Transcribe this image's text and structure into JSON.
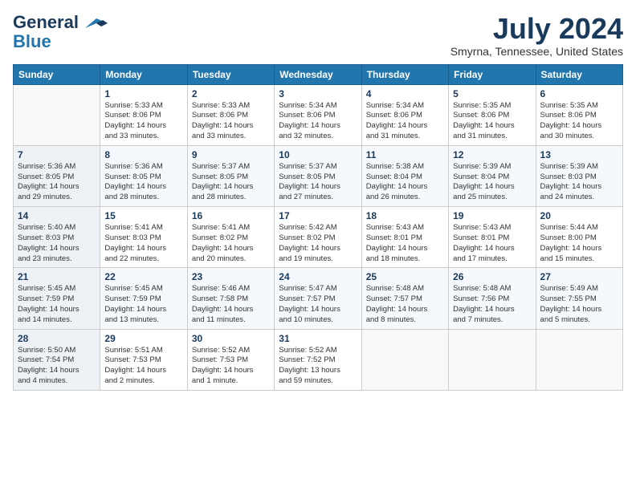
{
  "header": {
    "logo_line1": "General",
    "logo_line2": "Blue",
    "month_title": "July 2024",
    "location": "Smyrna, Tennessee, United States"
  },
  "weekdays": [
    "Sunday",
    "Monday",
    "Tuesday",
    "Wednesday",
    "Thursday",
    "Friday",
    "Saturday"
  ],
  "weeks": [
    [
      {
        "day": "",
        "info": ""
      },
      {
        "day": "1",
        "info": "Sunrise: 5:33 AM\nSunset: 8:06 PM\nDaylight: 14 hours\nand 33 minutes."
      },
      {
        "day": "2",
        "info": "Sunrise: 5:33 AM\nSunset: 8:06 PM\nDaylight: 14 hours\nand 33 minutes."
      },
      {
        "day": "3",
        "info": "Sunrise: 5:34 AM\nSunset: 8:06 PM\nDaylight: 14 hours\nand 32 minutes."
      },
      {
        "day": "4",
        "info": "Sunrise: 5:34 AM\nSunset: 8:06 PM\nDaylight: 14 hours\nand 31 minutes."
      },
      {
        "day": "5",
        "info": "Sunrise: 5:35 AM\nSunset: 8:06 PM\nDaylight: 14 hours\nand 31 minutes."
      },
      {
        "day": "6",
        "info": "Sunrise: 5:35 AM\nSunset: 8:06 PM\nDaylight: 14 hours\nand 30 minutes."
      }
    ],
    [
      {
        "day": "7",
        "info": "Sunrise: 5:36 AM\nSunset: 8:05 PM\nDaylight: 14 hours\nand 29 minutes."
      },
      {
        "day": "8",
        "info": "Sunrise: 5:36 AM\nSunset: 8:05 PM\nDaylight: 14 hours\nand 28 minutes."
      },
      {
        "day": "9",
        "info": "Sunrise: 5:37 AM\nSunset: 8:05 PM\nDaylight: 14 hours\nand 28 minutes."
      },
      {
        "day": "10",
        "info": "Sunrise: 5:37 AM\nSunset: 8:05 PM\nDaylight: 14 hours\nand 27 minutes."
      },
      {
        "day": "11",
        "info": "Sunrise: 5:38 AM\nSunset: 8:04 PM\nDaylight: 14 hours\nand 26 minutes."
      },
      {
        "day": "12",
        "info": "Sunrise: 5:39 AM\nSunset: 8:04 PM\nDaylight: 14 hours\nand 25 minutes."
      },
      {
        "day": "13",
        "info": "Sunrise: 5:39 AM\nSunset: 8:03 PM\nDaylight: 14 hours\nand 24 minutes."
      }
    ],
    [
      {
        "day": "14",
        "info": "Sunrise: 5:40 AM\nSunset: 8:03 PM\nDaylight: 14 hours\nand 23 minutes."
      },
      {
        "day": "15",
        "info": "Sunrise: 5:41 AM\nSunset: 8:03 PM\nDaylight: 14 hours\nand 22 minutes."
      },
      {
        "day": "16",
        "info": "Sunrise: 5:41 AM\nSunset: 8:02 PM\nDaylight: 14 hours\nand 20 minutes."
      },
      {
        "day": "17",
        "info": "Sunrise: 5:42 AM\nSunset: 8:02 PM\nDaylight: 14 hours\nand 19 minutes."
      },
      {
        "day": "18",
        "info": "Sunrise: 5:43 AM\nSunset: 8:01 PM\nDaylight: 14 hours\nand 18 minutes."
      },
      {
        "day": "19",
        "info": "Sunrise: 5:43 AM\nSunset: 8:01 PM\nDaylight: 14 hours\nand 17 minutes."
      },
      {
        "day": "20",
        "info": "Sunrise: 5:44 AM\nSunset: 8:00 PM\nDaylight: 14 hours\nand 15 minutes."
      }
    ],
    [
      {
        "day": "21",
        "info": "Sunrise: 5:45 AM\nSunset: 7:59 PM\nDaylight: 14 hours\nand 14 minutes."
      },
      {
        "day": "22",
        "info": "Sunrise: 5:45 AM\nSunset: 7:59 PM\nDaylight: 14 hours\nand 13 minutes."
      },
      {
        "day": "23",
        "info": "Sunrise: 5:46 AM\nSunset: 7:58 PM\nDaylight: 14 hours\nand 11 minutes."
      },
      {
        "day": "24",
        "info": "Sunrise: 5:47 AM\nSunset: 7:57 PM\nDaylight: 14 hours\nand 10 minutes."
      },
      {
        "day": "25",
        "info": "Sunrise: 5:48 AM\nSunset: 7:57 PM\nDaylight: 14 hours\nand 8 minutes."
      },
      {
        "day": "26",
        "info": "Sunrise: 5:48 AM\nSunset: 7:56 PM\nDaylight: 14 hours\nand 7 minutes."
      },
      {
        "day": "27",
        "info": "Sunrise: 5:49 AM\nSunset: 7:55 PM\nDaylight: 14 hours\nand 5 minutes."
      }
    ],
    [
      {
        "day": "28",
        "info": "Sunrise: 5:50 AM\nSunset: 7:54 PM\nDaylight: 14 hours\nand 4 minutes."
      },
      {
        "day": "29",
        "info": "Sunrise: 5:51 AM\nSunset: 7:53 PM\nDaylight: 14 hours\nand 2 minutes."
      },
      {
        "day": "30",
        "info": "Sunrise: 5:52 AM\nSunset: 7:53 PM\nDaylight: 14 hours\nand 1 minute."
      },
      {
        "day": "31",
        "info": "Sunrise: 5:52 AM\nSunset: 7:52 PM\nDaylight: 13 hours\nand 59 minutes."
      },
      {
        "day": "",
        "info": ""
      },
      {
        "day": "",
        "info": ""
      },
      {
        "day": "",
        "info": ""
      }
    ]
  ]
}
